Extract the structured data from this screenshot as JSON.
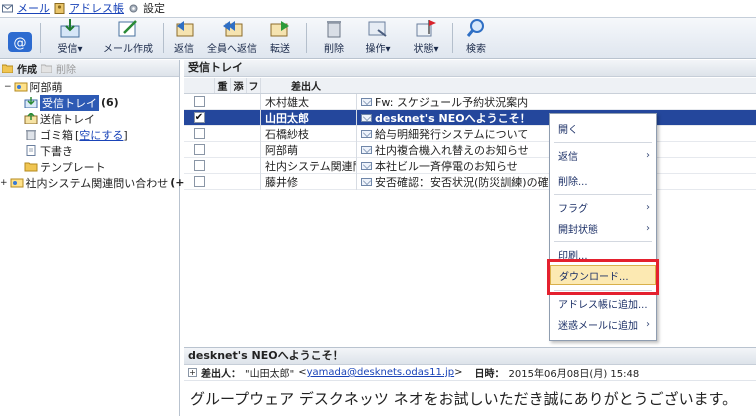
{
  "topnav": {
    "mail_label": "メール",
    "address_label": "アドレス帳",
    "settings_label": "設定"
  },
  "toolbar": {
    "receive": "受信",
    "compose": "メール作成",
    "reply": "返信",
    "reply_all": "全員へ返信",
    "forward": "転送",
    "delete": "削除",
    "operation": "操作",
    "status": "状態",
    "search": "検索"
  },
  "left": {
    "create": "作成",
    "delete": "削除",
    "account": "阿部萌",
    "inbox": "受信トレイ",
    "inbox_count": "(6)",
    "sent": "送信トレイ",
    "trash": "ゴミ箱",
    "empty_trash": "空にする",
    "drafts": "下書き",
    "templates": "テンプレート",
    "shared": "社内システム関連問い合わせ",
    "shared_count": "(+)"
  },
  "list": {
    "title": "受信トレイ",
    "headers": {
      "a": "重",
      "b": "添",
      "c": "フ",
      "from": "差出人"
    },
    "rows": [
      {
        "from": "木村雄太",
        "subject": "Fw: スケジュール予約状況案内"
      },
      {
        "from": "山田太郎",
        "subject": "desknet's NEOへようこそ！"
      },
      {
        "from": "石橋紗枝",
        "subject": "給与明細発行システムについて"
      },
      {
        "from": "阿部萌",
        "subject": "社内複合機入れ替えのお知らせ"
      },
      {
        "from": "社内システム関連問",
        "subject": "本社ビル一斉停電のお知らせ"
      },
      {
        "from": "藤井修",
        "subject": "安否確認：安否状況(防災訓練)の確認です"
      }
    ]
  },
  "menu": {
    "open": "開く",
    "reply": "返信",
    "delete": "削除...",
    "flag": "フラグ",
    "read_state": "開封状態",
    "print": "印刷...",
    "download": "ダウンロード...",
    "add_address": "アドレス帳に追加...",
    "add_spam": "迷惑メールに追加"
  },
  "preview": {
    "title": "desknet's NEOへようこそ！",
    "from_label": "差出人：",
    "from_name": "\"山田太郎\"",
    "from_email": "yamada@desknets.odas11.jp",
    "date_label": "日時：",
    "date": "2015年06月08日(月) 15:48",
    "body": "グループウェア デスクネッツ ネオをお試しいただき誠にありがとうございます。"
  },
  "colors": {
    "selected_row": "#24479c",
    "highlight": "#fce9b2",
    "red_box": "#e4202e",
    "link": "#1a44b8"
  }
}
